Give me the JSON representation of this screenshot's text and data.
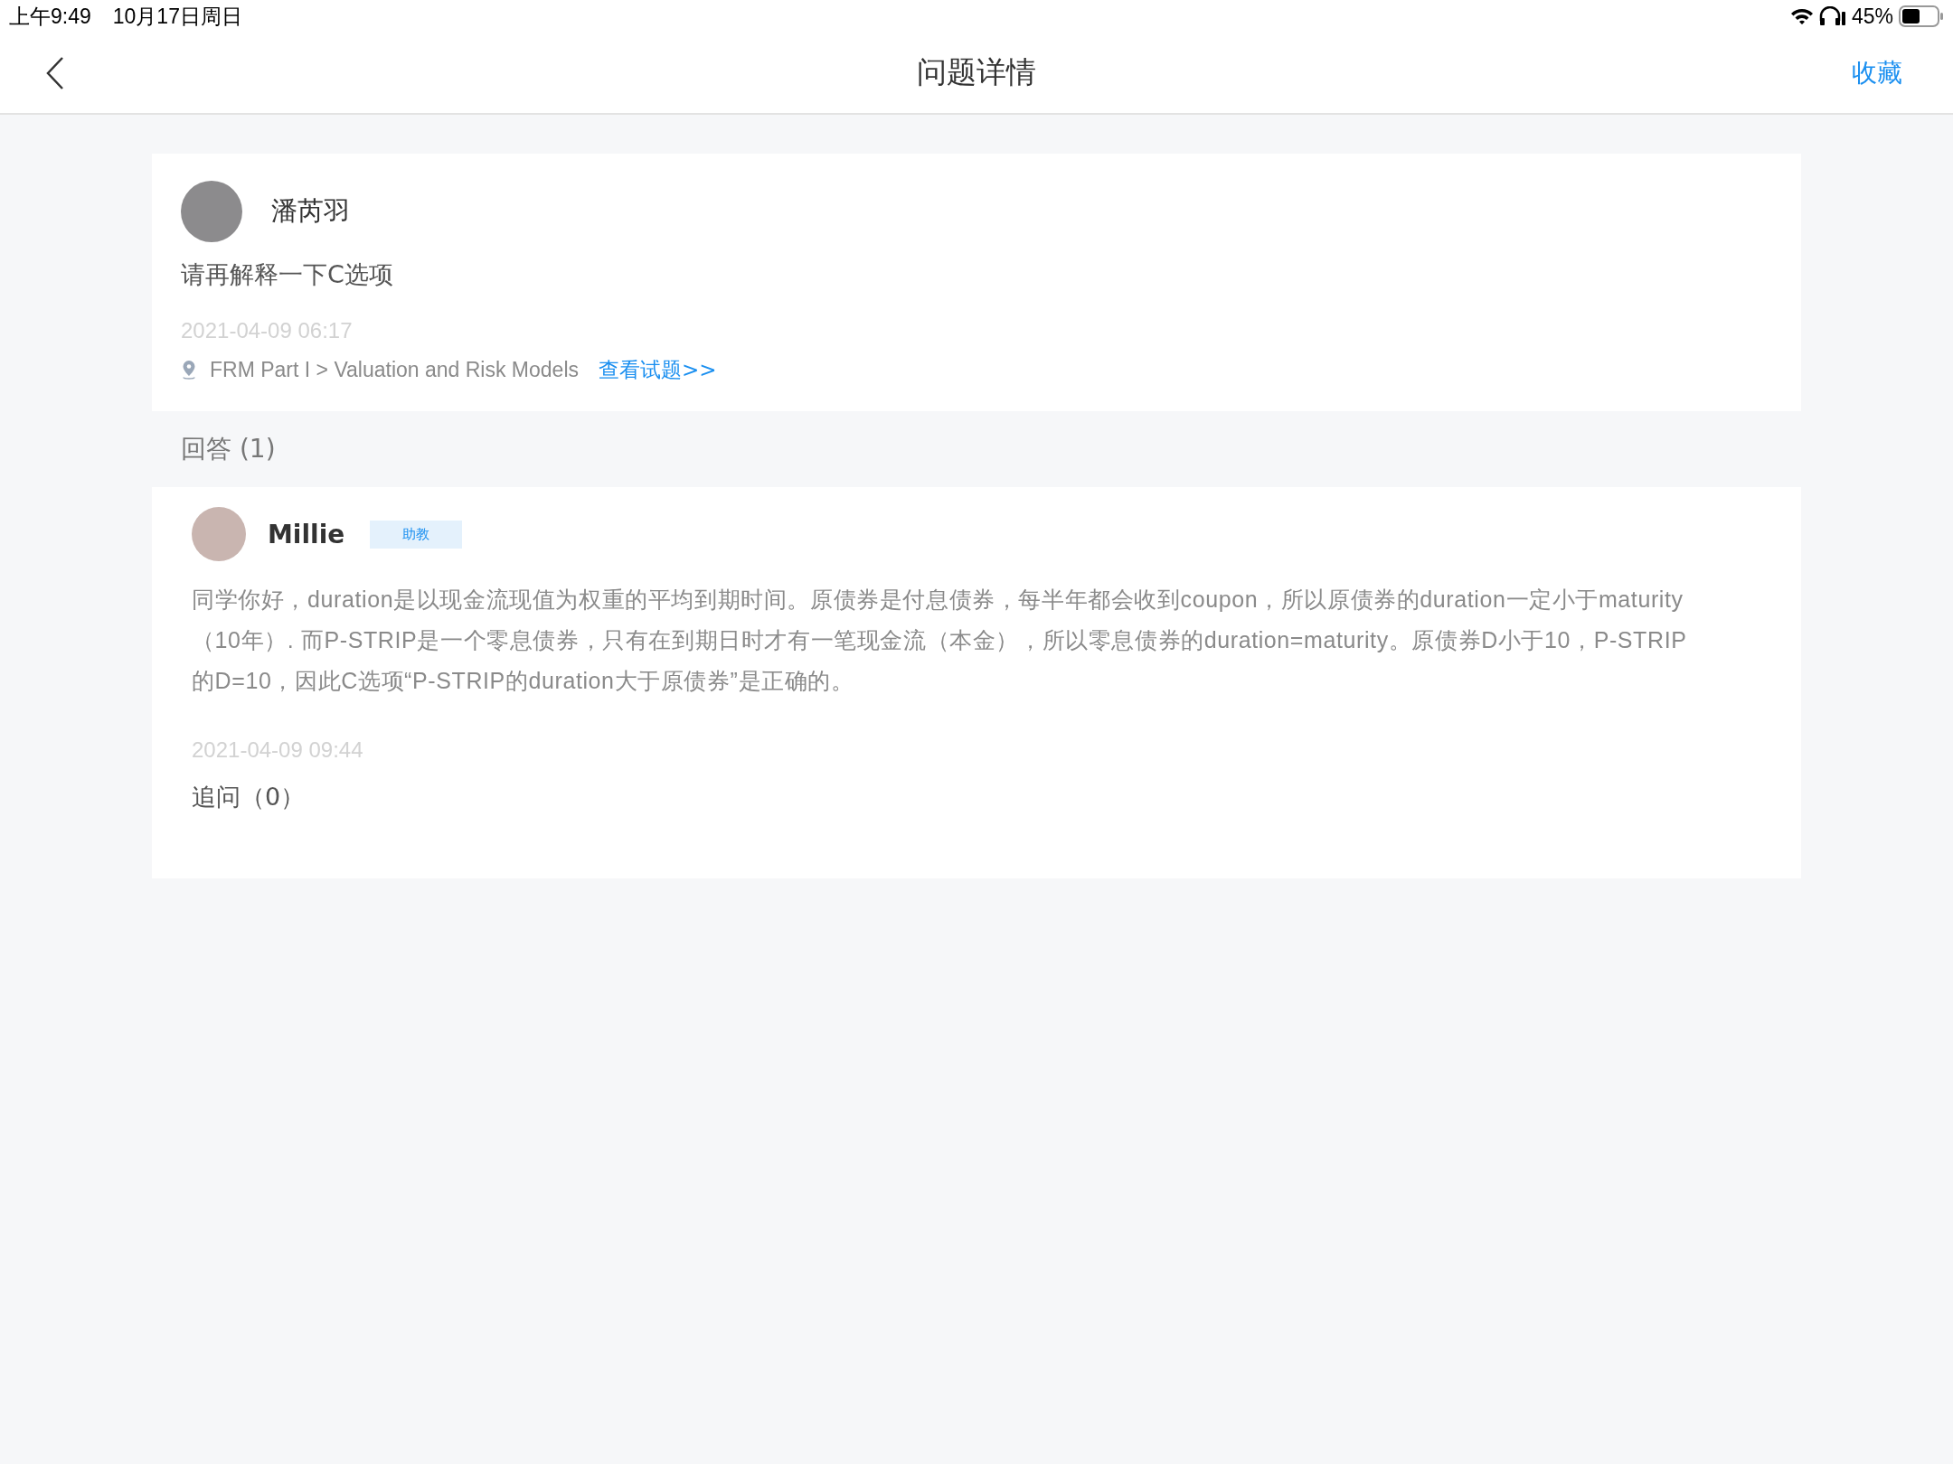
{
  "status_bar": {
    "time": "上午9:49",
    "date": "10月17日周日",
    "battery": "45%"
  },
  "nav": {
    "title": "问题详情",
    "action": "收藏"
  },
  "question": {
    "author": "潘芮羽",
    "text": "请再解释一下C选项",
    "time": "2021-04-09 06:17",
    "path": "FRM Part I > Valuation and Risk Models",
    "link": "查看试题>>"
  },
  "answers_header": "回答 (1)",
  "answers": [
    {
      "author": "Millie",
      "badge": "助教",
      "text": "同学你好，duration是以现金流现值为权重的平均到期时间。原债券是付息债券，每半年都会收到coupon，所以原债券的duration一定小于maturity（10年）. 而P-STRIP是一个零息债券，只有在到期日时才有一笔现金流（本金），所以零息债券的duration=maturity。原债券D小于10，P-STRIP 的D=10，因此C选项“P-STRIP的duration大于原债券”是正确的。",
      "time": "2021-04-09 09:44",
      "followup": "追问（0）"
    }
  ]
}
